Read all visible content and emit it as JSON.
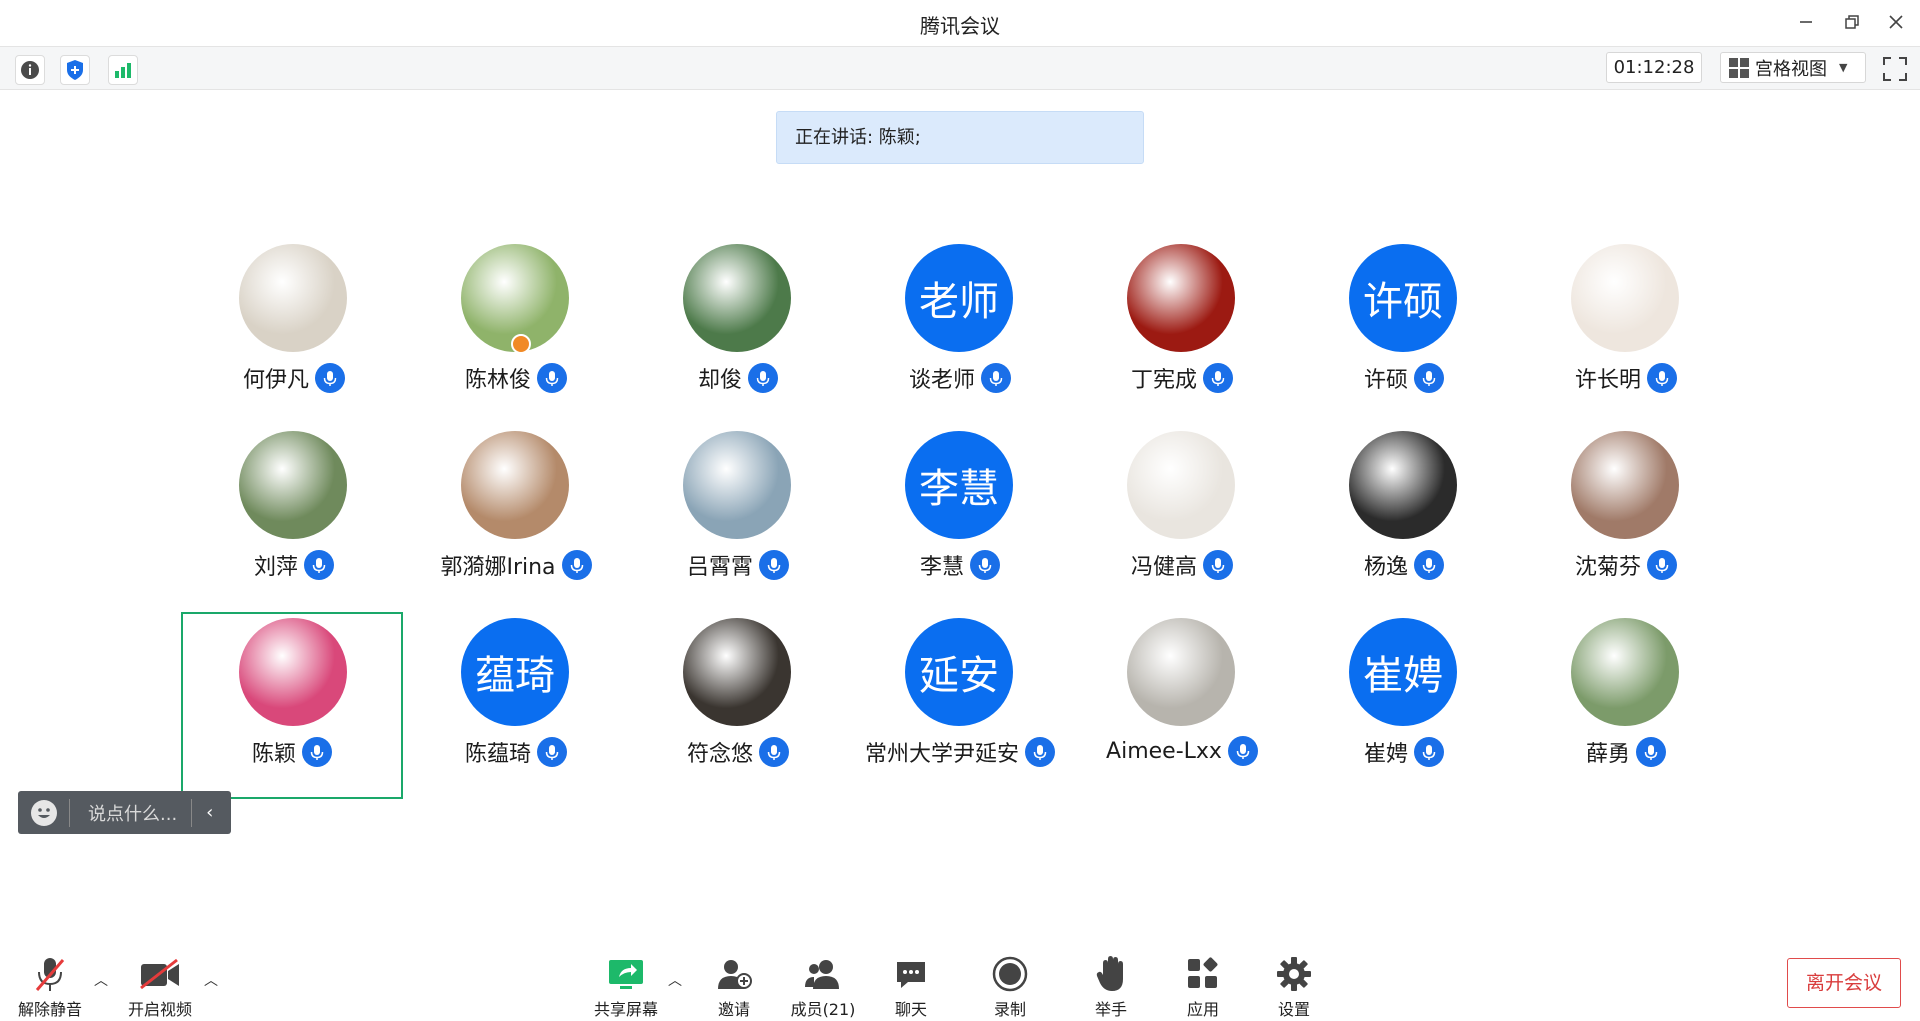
{
  "window": {
    "title": "腾讯会议"
  },
  "toolbar": {
    "timer": "01:12:28",
    "view_label": "宫格视图"
  },
  "speaking": {
    "text": "正在讲话: 陈颖;"
  },
  "participants": [
    {
      "name": "何伊凡",
      "avatar": "photo",
      "color": "#d9d2c6"
    },
    {
      "name": "陈林俊",
      "avatar": "photo",
      "color": "#8fb36a"
    },
    {
      "name": "却俊",
      "avatar": "photo",
      "color": "#4d7a4a"
    },
    {
      "name": "谈老师",
      "avatar": "text",
      "avatar_text": "老师"
    },
    {
      "name": "丁宪成",
      "avatar": "photo",
      "color": "#9c1a12"
    },
    {
      "name": "许硕",
      "avatar": "text",
      "avatar_text": "许硕"
    },
    {
      "name": "许长明",
      "avatar": "photo",
      "color": "#eee6de"
    },
    {
      "name": "刘萍",
      "avatar": "photo",
      "color": "#6f8a5c"
    },
    {
      "name": "郭漪娜Irina",
      "avatar": "photo",
      "color": "#b48a6a"
    },
    {
      "name": "吕霄霄",
      "avatar": "photo",
      "color": "#8aa4b6"
    },
    {
      "name": "李慧",
      "avatar": "text",
      "avatar_text": "李慧"
    },
    {
      "name": "冯健高",
      "avatar": "photo",
      "color": "#e9e5df"
    },
    {
      "name": "杨逸",
      "avatar": "photo",
      "color": "#2b2b2b"
    },
    {
      "name": "沈菊芬",
      "avatar": "photo",
      "color": "#a07a68"
    },
    {
      "name": "陈颖",
      "avatar": "photo",
      "color": "#d9487a"
    },
    {
      "name": "陈蕴琦",
      "avatar": "text",
      "avatar_text": "蕴琦"
    },
    {
      "name": "符念悠",
      "avatar": "photo",
      "color": "#3a3530"
    },
    {
      "name": "常州大学尹延安",
      "avatar": "text",
      "avatar_text": "延安"
    },
    {
      "name": "Aimee-Lxx",
      "avatar": "photo",
      "color": "#b7b4ad"
    },
    {
      "name": "崔娉",
      "avatar": "text",
      "avatar_text": "崔娉"
    },
    {
      "name": "薛勇",
      "avatar": "photo",
      "color": "#7c9b6a"
    }
  ],
  "chat": {
    "placeholder": "说点什么..."
  },
  "bottom": {
    "unmute": "解除静音",
    "start_video": "开启视频",
    "share_screen": "共享屏幕",
    "invite": "邀请",
    "members": "成员(21)",
    "chat": "聊天",
    "record": "录制",
    "raise_hand": "举手",
    "apps": "应用",
    "settings": "设置",
    "leave": "离开会议"
  },
  "colors": {
    "accent": "#0a6ef0",
    "active_border": "#1aa86a",
    "leave": "#d93c3c"
  }
}
